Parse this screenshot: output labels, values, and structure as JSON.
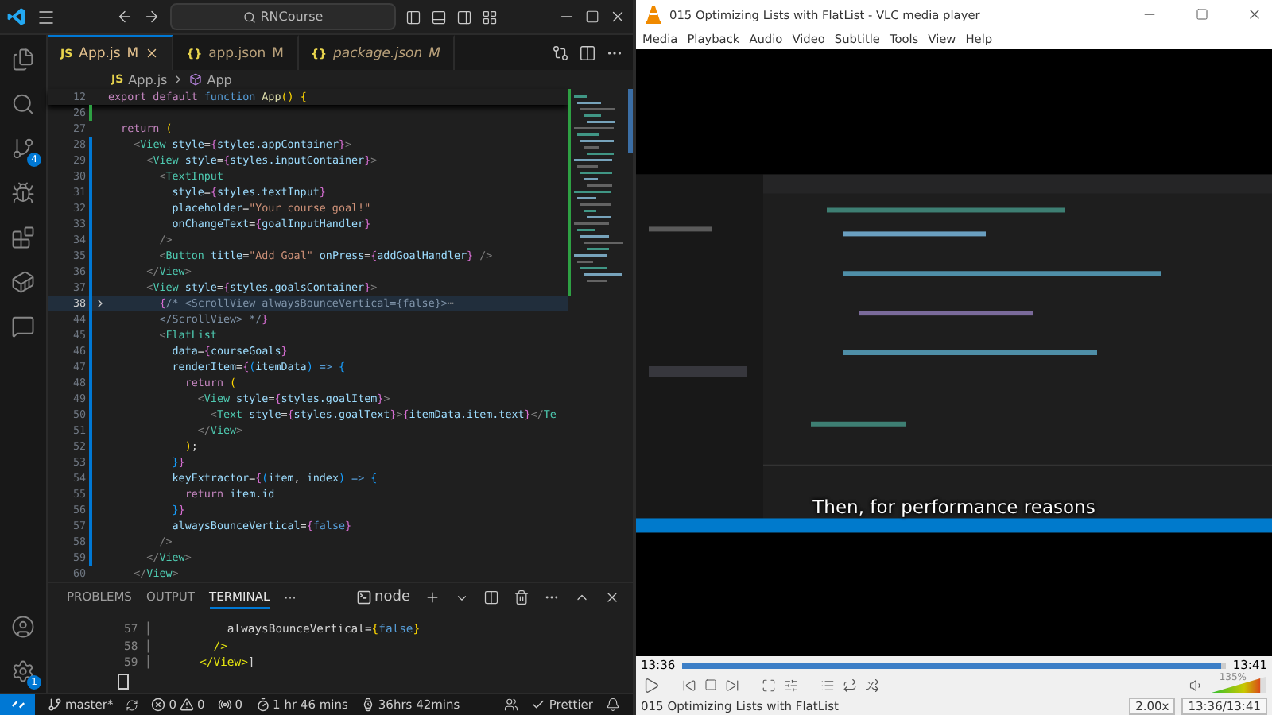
{
  "vscode": {
    "title_search": "RNCourse",
    "activity_bar": {
      "source_control_badge": "4",
      "settings_badge": "1"
    },
    "tabs": [
      {
        "file_icon": "JS",
        "label": "App.js",
        "status": "M",
        "selected": true,
        "preview": false
      },
      {
        "file_icon": "{}",
        "label": "app.json",
        "status": "M",
        "selected": false,
        "preview": false
      },
      {
        "file_icon": "{}",
        "label": "package.json",
        "status": "M",
        "selected": false,
        "preview": true
      }
    ],
    "breadcrumb": {
      "file_icon": "JS",
      "file": "App.js",
      "symbol": "App"
    },
    "editor": {
      "sticky_line": {
        "number": "12",
        "code": [
          {
            "kind": "kw",
            "text": "export default "
          },
          {
            "kind": "kwb",
            "text": "function "
          },
          {
            "kind": "fn",
            "text": "App"
          },
          {
            "kind": "b1",
            "text": "() {"
          }
        ]
      },
      "lines": [
        {
          "number": "26",
          "selected": false,
          "folded": false,
          "added": true,
          "modified": false
        },
        {
          "number": "27",
          "selected": false,
          "folded": false,
          "added": false,
          "modified": false,
          "code": [
            {
              "kind": "kw",
              "text": "  return "
            },
            {
              "kind": "b1",
              "text": "("
            }
          ]
        },
        {
          "number": "28",
          "selected": false,
          "folded": false,
          "added": false,
          "modified": true,
          "code": [
            {
              "kind": "pun",
              "text": "    <"
            },
            {
              "kind": "tag",
              "text": "View "
            },
            {
              "kind": "attr",
              "text": "style"
            },
            {
              "kind": "pl",
              "text": "="
            },
            {
              "kind": "b2",
              "text": "{"
            },
            {
              "kind": "var",
              "text": "styles.appContainer"
            },
            {
              "kind": "b2",
              "text": "}"
            },
            {
              "kind": "pun",
              "text": ">"
            }
          ]
        },
        {
          "number": "29",
          "selected": false,
          "folded": false,
          "added": false,
          "modified": true,
          "code": [
            {
              "kind": "pun",
              "text": "      <"
            },
            {
              "kind": "tag",
              "text": "View "
            },
            {
              "kind": "attr",
              "text": "style"
            },
            {
              "kind": "pl",
              "text": "="
            },
            {
              "kind": "b2",
              "text": "{"
            },
            {
              "kind": "var",
              "text": "styles.inputContainer"
            },
            {
              "kind": "b2",
              "text": "}"
            },
            {
              "kind": "pun",
              "text": ">"
            }
          ]
        },
        {
          "number": "30",
          "selected": false,
          "folded": false,
          "added": false,
          "modified": true,
          "code": [
            {
              "kind": "pun",
              "text": "        <"
            },
            {
              "kind": "tag",
              "text": "TextInput"
            }
          ]
        },
        {
          "number": "31",
          "selected": false,
          "folded": false,
          "added": false,
          "modified": true,
          "code": [
            {
              "kind": "attr",
              "text": "          style"
            },
            {
              "kind": "pl",
              "text": "="
            },
            {
              "kind": "b2",
              "text": "{"
            },
            {
              "kind": "var",
              "text": "styles.textInput"
            },
            {
              "kind": "b2",
              "text": "}"
            }
          ]
        },
        {
          "number": "32",
          "selected": false,
          "folded": false,
          "added": false,
          "modified": true,
          "code": [
            {
              "kind": "attr",
              "text": "          placeholder"
            },
            {
              "kind": "pl",
              "text": "="
            },
            {
              "kind": "str",
              "text": "\"Your course goal!\""
            }
          ]
        },
        {
          "number": "33",
          "selected": false,
          "folded": false,
          "added": false,
          "modified": true,
          "code": [
            {
              "kind": "attr",
              "text": "          onChangeText"
            },
            {
              "kind": "pl",
              "text": "="
            },
            {
              "kind": "b2",
              "text": "{"
            },
            {
              "kind": "var",
              "text": "goalInputHandler"
            },
            {
              "kind": "b2",
              "text": "}"
            }
          ]
        },
        {
          "number": "34",
          "selected": false,
          "folded": false,
          "added": false,
          "modified": true,
          "code": [
            {
              "kind": "pun",
              "text": "        />"
            }
          ]
        },
        {
          "number": "35",
          "selected": false,
          "folded": false,
          "added": false,
          "modified": true,
          "code": [
            {
              "kind": "pun",
              "text": "        <"
            },
            {
              "kind": "tag",
              "text": "Button "
            },
            {
              "kind": "attr",
              "text": "title"
            },
            {
              "kind": "pl",
              "text": "="
            },
            {
              "kind": "str",
              "text": "\"Add Goal\" "
            },
            {
              "kind": "attr",
              "text": "onPress"
            },
            {
              "kind": "pl",
              "text": "="
            },
            {
              "kind": "b2",
              "text": "{"
            },
            {
              "kind": "var",
              "text": "addGoalHandler"
            },
            {
              "kind": "b2",
              "text": "}"
            },
            {
              "kind": "pun",
              "text": " />"
            }
          ]
        },
        {
          "number": "36",
          "selected": false,
          "folded": false,
          "added": false,
          "modified": true,
          "code": [
            {
              "kind": "pun",
              "text": "      </"
            },
            {
              "kind": "tag",
              "text": "View"
            },
            {
              "kind": "pun",
              "text": ">"
            }
          ]
        },
        {
          "number": "37",
          "selected": false,
          "folded": false,
          "added": false,
          "modified": true,
          "code": [
            {
              "kind": "pun",
              "text": "      <"
            },
            {
              "kind": "tag",
              "text": "View "
            },
            {
              "kind": "attr",
              "text": "style"
            },
            {
              "kind": "pl",
              "text": "="
            },
            {
              "kind": "b2",
              "text": "{"
            },
            {
              "kind": "var",
              "text": "styles.goalsContainer"
            },
            {
              "kind": "b2",
              "text": "}"
            },
            {
              "kind": "pun",
              "text": ">"
            }
          ]
        },
        {
          "number": "38",
          "selected": true,
          "folded": true,
          "added": false,
          "modified": true,
          "code": [
            {
              "kind": "b2",
              "text": "        {"
            },
            {
              "kind": "cmt",
              "text": "/* <ScrollView alwaysBounceVertical={false}>"
            },
            {
              "kind": "fold",
              "text": "⋯"
            }
          ]
        },
        {
          "number": "44",
          "selected": false,
          "folded": false,
          "added": false,
          "modified": true,
          "code": [
            {
              "kind": "cmt",
              "text": "        </ScrollView> */"
            },
            {
              "kind": "b2",
              "text": "}"
            }
          ]
        },
        {
          "number": "45",
          "selected": false,
          "folded": false,
          "added": false,
          "modified": true,
          "code": [
            {
              "kind": "pun",
              "text": "        <"
            },
            {
              "kind": "tag",
              "text": "FlatList"
            }
          ]
        },
        {
          "number": "46",
          "selected": false,
          "folded": false,
          "added": false,
          "modified": true,
          "code": [
            {
              "kind": "attr",
              "text": "          data"
            },
            {
              "kind": "pl",
              "text": "="
            },
            {
              "kind": "b2",
              "text": "{"
            },
            {
              "kind": "var",
              "text": "courseGoals"
            },
            {
              "kind": "b2",
              "text": "}"
            }
          ]
        },
        {
          "number": "47",
          "selected": false,
          "folded": false,
          "added": false,
          "modified": true,
          "code": [
            {
              "kind": "attr",
              "text": "          renderItem"
            },
            {
              "kind": "pl",
              "text": "="
            },
            {
              "kind": "b2",
              "text": "{"
            },
            {
              "kind": "b3",
              "text": "("
            },
            {
              "kind": "var",
              "text": "itemData"
            },
            {
              "kind": "b3",
              "text": ")"
            },
            {
              "kind": "kwb",
              "text": " => "
            },
            {
              "kind": "b3",
              "text": "{"
            }
          ]
        },
        {
          "number": "48",
          "selected": false,
          "folded": false,
          "added": false,
          "modified": true,
          "code": [
            {
              "kind": "kw",
              "text": "            return "
            },
            {
              "kind": "b1",
              "text": "("
            }
          ]
        },
        {
          "number": "49",
          "selected": false,
          "folded": false,
          "added": false,
          "modified": true,
          "code": [
            {
              "kind": "pun",
              "text": "              <"
            },
            {
              "kind": "tag",
              "text": "View "
            },
            {
              "kind": "attr",
              "text": "style"
            },
            {
              "kind": "pl",
              "text": "="
            },
            {
              "kind": "b2",
              "text": "{"
            },
            {
              "kind": "var",
              "text": "styles.goalItem"
            },
            {
              "kind": "b2",
              "text": "}"
            },
            {
              "kind": "pun",
              "text": ">"
            }
          ]
        },
        {
          "number": "50",
          "selected": false,
          "folded": false,
          "added": false,
          "modified": true,
          "code": [
            {
              "kind": "pun",
              "text": "                <"
            },
            {
              "kind": "tag",
              "text": "Text "
            },
            {
              "kind": "attr",
              "text": "style"
            },
            {
              "kind": "pl",
              "text": "="
            },
            {
              "kind": "b2",
              "text": "{"
            },
            {
              "kind": "var",
              "text": "styles.goalText"
            },
            {
              "kind": "b2",
              "text": "}"
            },
            {
              "kind": "pun",
              "text": ">"
            },
            {
              "kind": "b2",
              "text": "{"
            },
            {
              "kind": "var",
              "text": "itemData.item.text"
            },
            {
              "kind": "b2",
              "text": "}"
            },
            {
              "kind": "pun",
              "text": "</"
            },
            {
              "kind": "tag",
              "text": "Te"
            }
          ]
        },
        {
          "number": "51",
          "selected": false,
          "folded": false,
          "added": false,
          "modified": true,
          "code": [
            {
              "kind": "pun",
              "text": "              </"
            },
            {
              "kind": "tag",
              "text": "View"
            },
            {
              "kind": "pun",
              "text": ">"
            }
          ]
        },
        {
          "number": "52",
          "selected": false,
          "folded": false,
          "added": false,
          "modified": true,
          "code": [
            {
              "kind": "b1",
              "text": "            )"
            },
            {
              "kind": "pl",
              "text": ";"
            }
          ]
        },
        {
          "number": "53",
          "selected": false,
          "folded": false,
          "added": false,
          "modified": true,
          "code": [
            {
              "kind": "b3",
              "text": "          }"
            },
            {
              "kind": "b2",
              "text": "}"
            }
          ]
        },
        {
          "number": "54",
          "selected": false,
          "folded": false,
          "added": false,
          "modified": true,
          "code": [
            {
              "kind": "attr",
              "text": "          keyExtractor"
            },
            {
              "kind": "pl",
              "text": "="
            },
            {
              "kind": "b2",
              "text": "{"
            },
            {
              "kind": "b3",
              "text": "("
            },
            {
              "kind": "var",
              "text": "item"
            },
            {
              "kind": "pl",
              "text": ", "
            },
            {
              "kind": "var",
              "text": "index"
            },
            {
              "kind": "b3",
              "text": ")"
            },
            {
              "kind": "kwb",
              "text": " => "
            },
            {
              "kind": "b3",
              "text": "{"
            }
          ]
        },
        {
          "number": "55",
          "selected": false,
          "folded": false,
          "added": false,
          "modified": true,
          "code": [
            {
              "kind": "kw",
              "text": "            return "
            },
            {
              "kind": "var",
              "text": "item.id"
            }
          ]
        },
        {
          "number": "56",
          "selected": false,
          "folded": false,
          "added": false,
          "modified": true,
          "code": [
            {
              "kind": "b3",
              "text": "          }"
            },
            {
              "kind": "b2",
              "text": "}"
            }
          ]
        },
        {
          "number": "57",
          "selected": false,
          "folded": false,
          "added": false,
          "modified": true,
          "code": [
            {
              "kind": "attr",
              "text": "          alwaysBounceVertical"
            },
            {
              "kind": "pl",
              "text": "="
            },
            {
              "kind": "b2",
              "text": "{"
            },
            {
              "kind": "kwb",
              "text": "false"
            },
            {
              "kind": "b2",
              "text": "}"
            }
          ]
        },
        {
          "number": "58",
          "selected": false,
          "folded": false,
          "added": false,
          "modified": true,
          "code": [
            {
              "kind": "pun",
              "text": "        />"
            }
          ]
        },
        {
          "number": "59",
          "selected": false,
          "folded": false,
          "added": false,
          "modified": true,
          "code": [
            {
              "kind": "pun",
              "text": "      </"
            },
            {
              "kind": "tag",
              "text": "View"
            },
            {
              "kind": "pun",
              "text": ">"
            }
          ]
        },
        {
          "number": "60",
          "selected": false,
          "folded": false,
          "added": false,
          "modified": false,
          "code": [
            {
              "kind": "pun",
              "text": "    </"
            },
            {
              "kind": "tag",
              "text": "View"
            },
            {
              "kind": "pun",
              "text": ">"
            }
          ]
        }
      ]
    },
    "panel": {
      "tabs": [
        {
          "label": "PROBLEMS",
          "selected": false
        },
        {
          "label": "OUTPUT",
          "selected": false
        },
        {
          "label": "TERMINAL",
          "selected": true
        }
      ],
      "more": "···",
      "terminal_name": "node",
      "terminal_lines": [
        [
          {
            "kind": "dim",
            "text": "57 │ "
          },
          {
            "kind": "pl",
            "text": "          alwaysBounceVertical="
          },
          {
            "kind": "b1",
            "text": "{"
          },
          {
            "kind": "kwb",
            "text": "false"
          },
          {
            "kind": "b1",
            "text": "}"
          }
        ],
        [
          {
            "kind": "dim",
            "text": "58 │ "
          },
          {
            "kind": "yel",
            "text": "        />"
          }
        ],
        [
          {
            "kind": "dim",
            "text": "59 │ "
          },
          {
            "kind": "yel",
            "text": "      </View>"
          },
          {
            "kind": "pl",
            "text": "]"
          }
        ]
      ]
    },
    "status_bar": {
      "branch": "master*",
      "errors": "0",
      "warnings": "0",
      "ports": "0",
      "session_time": "1 hr 46 mins",
      "total_time": "36hrs 42mins",
      "formatter": "Prettier"
    }
  },
  "vlc": {
    "title": "015 Optimizing Lists with FlatList - VLC media player",
    "menu": [
      "Media",
      "Playback",
      "Audio",
      "Video",
      "Subtitle",
      "Tools",
      "View",
      "Help"
    ],
    "subtitle": "Then, for performance reasons",
    "elapsed": "13:36",
    "total": "13:41",
    "seek": {
      "level": 0.99
    },
    "volume": {
      "reading": "135%",
      "level": 0.9
    },
    "now_playing": "015 Optimizing Lists with FlatList",
    "speed": "2.00x",
    "time_display": "13:36/13:41"
  }
}
